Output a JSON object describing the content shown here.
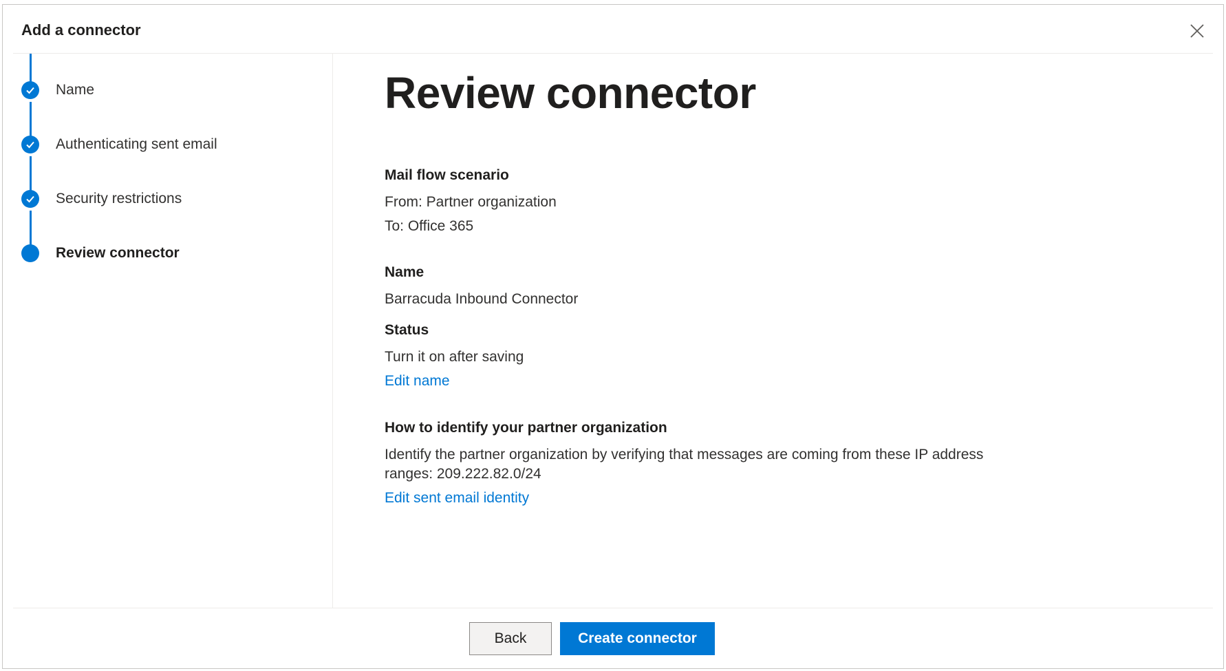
{
  "dialog": {
    "title": "Add a connector",
    "close_label": "Close"
  },
  "steps": [
    {
      "label": "Name",
      "state": "completed"
    },
    {
      "label": "Authenticating sent email",
      "state": "completed"
    },
    {
      "label": "Security restrictions",
      "state": "completed"
    },
    {
      "label": "Review connector",
      "state": "current"
    }
  ],
  "review": {
    "title": "Review connector",
    "mail_flow": {
      "heading": "Mail flow scenario",
      "from": "From: Partner organization",
      "to": "To: Office 365"
    },
    "name": {
      "heading": "Name",
      "value": "Barracuda Inbound Connector"
    },
    "status": {
      "heading": "Status",
      "value": "Turn it on after saving",
      "edit_link": "Edit name"
    },
    "identify": {
      "heading": "How to identify your partner organization",
      "line1": "Identify the partner organization by verifying that messages are coming from these IP address",
      "line2": "ranges: 209.222.82.0/24",
      "edit_link": "Edit sent email identity"
    }
  },
  "footer": {
    "back_label": "Back",
    "create_label": "Create connector"
  },
  "colors": {
    "accent": "#0078d4",
    "text": "#323130",
    "divider": "#edebe9"
  }
}
